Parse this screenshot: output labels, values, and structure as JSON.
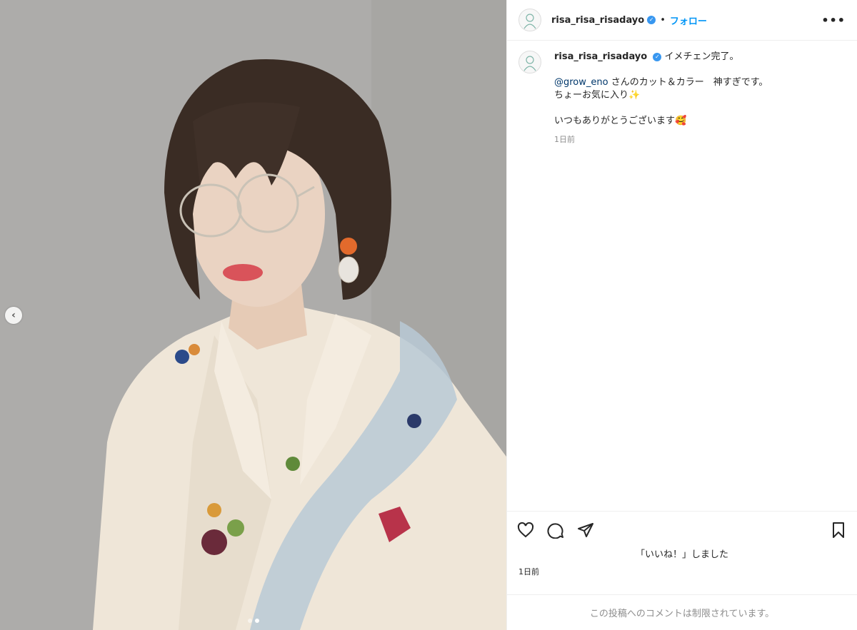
{
  "post": {
    "username": "risa_risa_risadayo",
    "follow_label": "フォロー",
    "separator": "•",
    "more_label": "•••",
    "caption_title": "イメチェン完了。",
    "mention": "@grow_eno",
    "caption_line1_rest": " さんのカット＆カラー　神すぎです。",
    "caption_line2": "ちょーお気に入り✨",
    "caption_line3": "いつもありがとうございます🥰",
    "caption_time": "1日前",
    "likes_text": "「いいね！」しました",
    "post_time": "1日前",
    "comments_disabled": "この投稿へのコメントは制限されています。"
  },
  "carousel": {
    "prev_label": "‹",
    "slide_count": 2,
    "active_index": 1
  },
  "icons": [
    "avatar-icon",
    "verified-icon",
    "more-icon",
    "heart-icon",
    "comment-icon",
    "share-icon",
    "bookmark-icon",
    "chevron-left-icon"
  ],
  "colors": {
    "link": "#0095f6",
    "mention": "#00376b",
    "verified": "#3897f0",
    "muted": "#8e8e8e"
  }
}
